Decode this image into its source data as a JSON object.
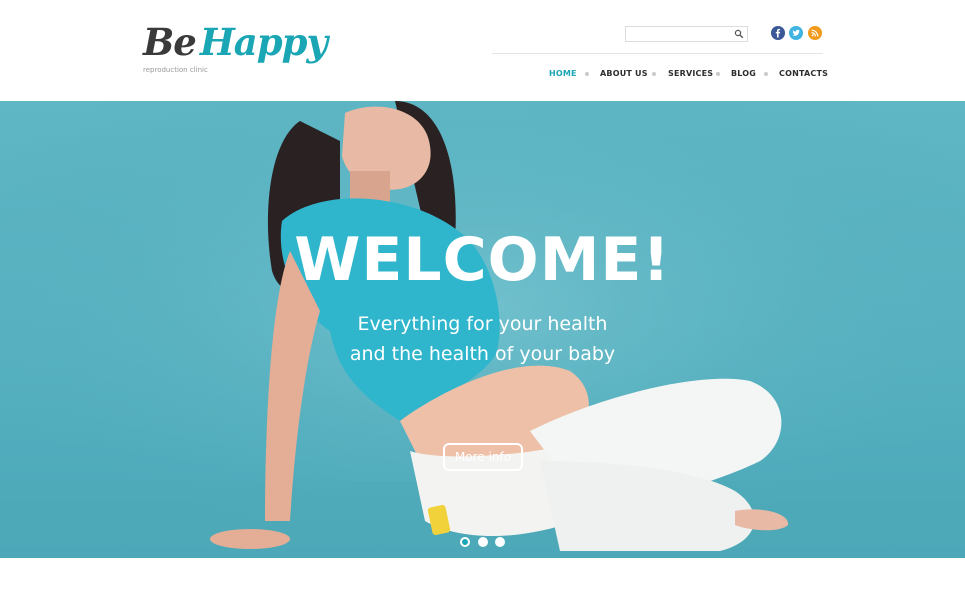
{
  "brand": {
    "word1": "Be",
    "word2": "Happy",
    "tagline": "reproduction clinic",
    "colors": {
      "dark": "#3a3a3a",
      "accent": "#1aa6b4"
    }
  },
  "search": {
    "placeholder": "",
    "icon": "search-icon"
  },
  "social": [
    {
      "name": "facebook",
      "glyph": "f"
    },
    {
      "name": "twitter",
      "glyph": "t"
    },
    {
      "name": "rss",
      "glyph": "rss"
    }
  ],
  "nav": {
    "items": [
      {
        "label": "HOME",
        "active": true
      },
      {
        "label": "ABOUT US",
        "active": false
      },
      {
        "label": "SERVICES",
        "active": false
      },
      {
        "label": "BLOG",
        "active": false
      },
      {
        "label": "CONTACTS",
        "active": false
      }
    ]
  },
  "hero": {
    "title": "WELCOME!",
    "subtitle_line1": "Everything for your health",
    "subtitle_line2": "and the health of your baby",
    "button_label": "More info",
    "slides": {
      "count": 3,
      "active_index": 0
    }
  }
}
